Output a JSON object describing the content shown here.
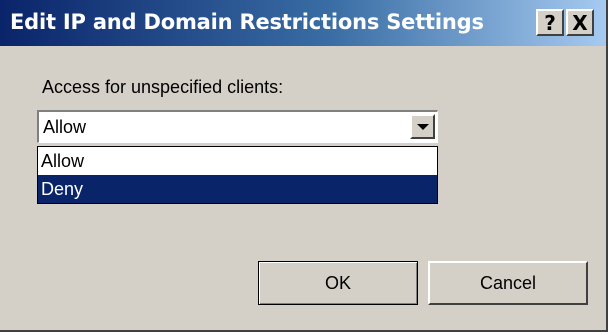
{
  "window": {
    "title": "Edit IP and Domain Restrictions Settings",
    "help_button": "?",
    "close_button": "X",
    "icons": [
      "help-icon",
      "close-icon"
    ]
  },
  "form": {
    "access_label": "Access for unspecified clients:",
    "access_value": "Allow",
    "options": [
      {
        "label": "Allow",
        "highlighted": false
      },
      {
        "label": "Deny",
        "highlighted": true
      }
    ]
  },
  "buttons": {
    "ok": "OK",
    "cancel": "Cancel"
  },
  "colors": {
    "titlebar_start": "#0a246a",
    "titlebar_end": "#a6caf0",
    "dialog_bg": "#d4d0c8",
    "selection": "#0a246a"
  }
}
